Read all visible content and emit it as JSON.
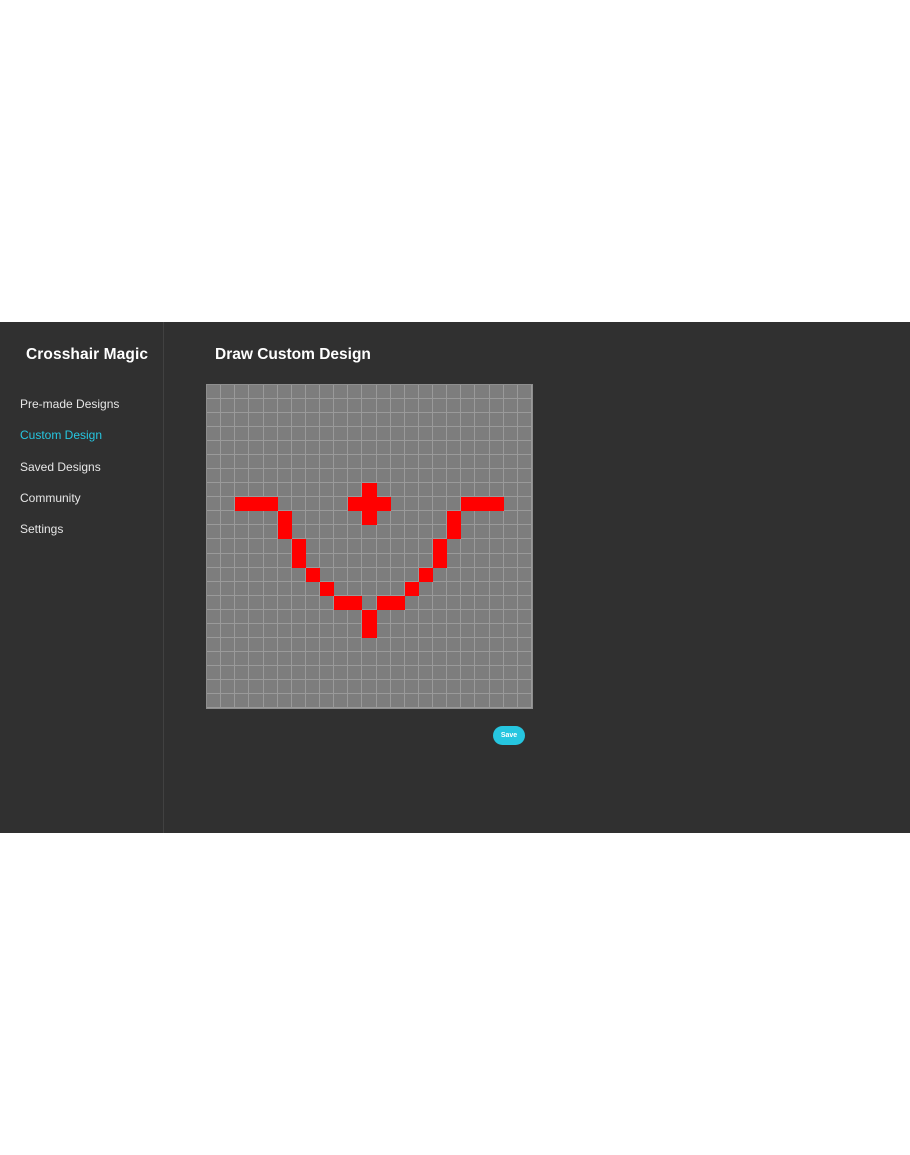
{
  "sidebar": {
    "brand": "Crosshair Magic",
    "items": [
      {
        "label": "Pre-made Designs",
        "active": false
      },
      {
        "label": "Custom Design",
        "active": true
      },
      {
        "label": "Saved Designs",
        "active": false
      },
      {
        "label": "Community",
        "active": false
      },
      {
        "label": "Settings",
        "active": false
      }
    ]
  },
  "main": {
    "title": "Draw Custom Design",
    "save_label": "Save"
  },
  "canvas": {
    "columns": 23,
    "rows": 23,
    "filled_color": "#ff0000",
    "empty_color": "#7d7d7d",
    "filled_cells": [
      [
        7,
        11
      ],
      [
        8,
        2
      ],
      [
        8,
        3
      ],
      [
        8,
        4
      ],
      [
        8,
        10
      ],
      [
        8,
        11
      ],
      [
        8,
        12
      ],
      [
        8,
        18
      ],
      [
        8,
        19
      ],
      [
        8,
        20
      ],
      [
        9,
        5
      ],
      [
        9,
        11
      ],
      [
        9,
        17
      ],
      [
        10,
        5
      ],
      [
        10,
        17
      ],
      [
        11,
        6
      ],
      [
        11,
        16
      ],
      [
        12,
        6
      ],
      [
        12,
        16
      ],
      [
        13,
        7
      ],
      [
        13,
        15
      ],
      [
        14,
        8
      ],
      [
        14,
        14
      ],
      [
        15,
        9
      ],
      [
        15,
        10
      ],
      [
        15,
        12
      ],
      [
        15,
        13
      ],
      [
        16,
        11
      ],
      [
        17,
        11
      ]
    ]
  },
  "colors": {
    "accent": "#26c6e0",
    "background": "#303030"
  }
}
